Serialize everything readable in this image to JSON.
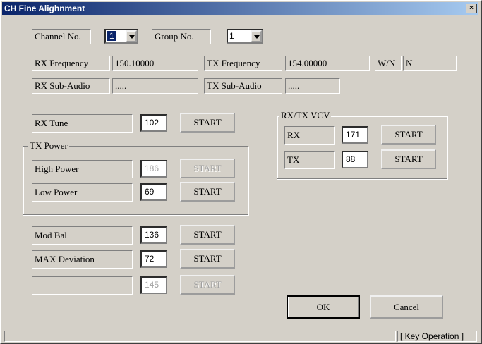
{
  "window": {
    "title": "CH Fine Alighnment",
    "close_label": "×"
  },
  "top": {
    "channel_label": "Channel No.",
    "channel_value": "1",
    "group_label": "Group No.",
    "group_value": "1"
  },
  "info": {
    "rx_freq_label": "RX Frequency",
    "rx_freq_value": "150.10000",
    "tx_freq_label": "TX Frequency",
    "tx_freq_value": "154.00000",
    "wn_label": "W/N",
    "wn_value": "N",
    "rx_sub_label": "RX Sub-Audio",
    "rx_sub_value": ".....",
    "tx_sub_label": "TX Sub-Audio",
    "tx_sub_value": "....."
  },
  "rows": {
    "rx_tune": {
      "label": "RX Tune",
      "value": "102",
      "button": "START"
    },
    "tx_power_group": "TX Power",
    "high_power": {
      "label": "High Power",
      "value": "186",
      "button": "START"
    },
    "low_power": {
      "label": "Low Power",
      "value": "69",
      "button": "START"
    },
    "mod_bal": {
      "label": "Mod Bal",
      "value": "136",
      "button": "START"
    },
    "max_dev": {
      "label": "MAX Deviation",
      "value": "72",
      "button": "START"
    },
    "blank": {
      "label": "",
      "value": "145",
      "button": "START"
    }
  },
  "vcv": {
    "group": "RX/TX VCV",
    "rx": {
      "label": "RX",
      "value": "171",
      "button": "START"
    },
    "tx": {
      "label": "TX",
      "value": "88",
      "button": "START"
    }
  },
  "buttons": {
    "ok": "OK",
    "cancel": "Cancel"
  },
  "status": {
    "right": "[ Key Operation ]"
  }
}
